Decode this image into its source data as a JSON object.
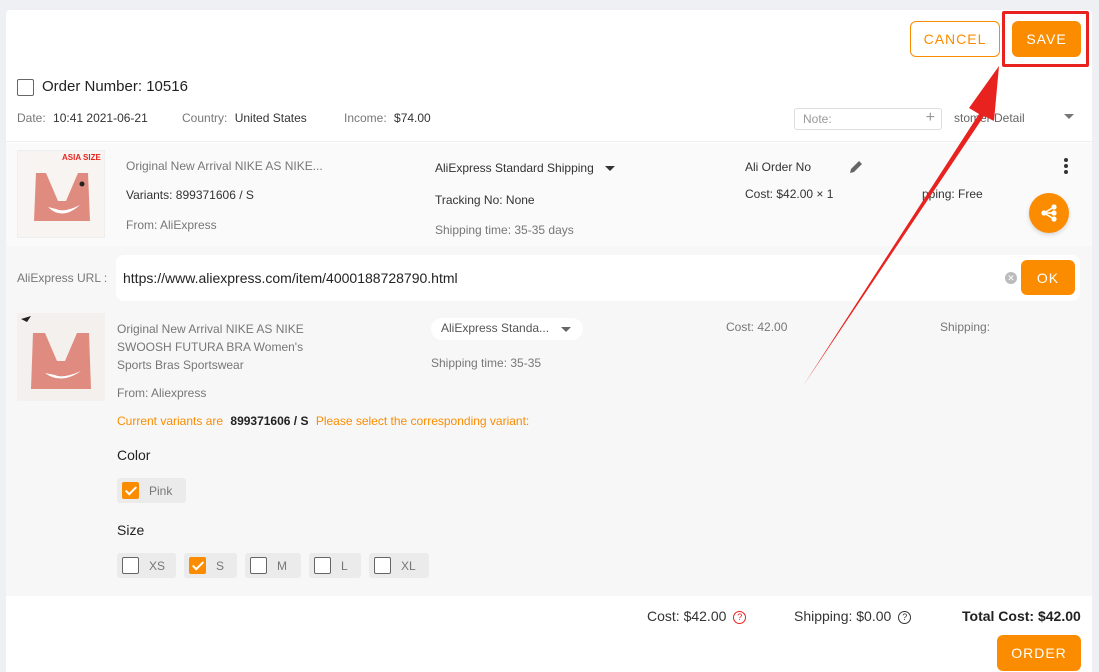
{
  "header": {
    "cancel_label": "CANCEL",
    "save_label": "SAVE"
  },
  "order": {
    "number_label": "Order Number: 10516",
    "date_label": "Date:",
    "date_value": "10:41 2021-06-21",
    "country_label": "Country:",
    "country_value": "United States",
    "income_label": "Income:",
    "income_value": "$74.00",
    "note_placeholder": "Note:",
    "customer_detail": "stomer Detail"
  },
  "item": {
    "badge": "ASIA SIZE",
    "title": "Original New Arrival NIKE AS NIKE...",
    "variants": "Variants: 899371606 / S",
    "from": "From: AliExpress",
    "shipping_method": "AliExpress Standard Shipping",
    "tracking": "Tracking No: None",
    "shipping_time": "Shipping time: 35-35 days",
    "ali_order_no": "Ali Order No",
    "cost": "Cost: $42.00 × 1",
    "shipping": "pping: Free"
  },
  "mapping": {
    "url_label": "AliExpress URL :",
    "url_value": "https://www.aliexpress.com/item/4000188728790.html",
    "ok_label": "OK",
    "product_title_line1": "Original New Arrival NIKE AS NIKE",
    "product_title_line2": "SWOOSH FUTURA BRA Women's",
    "product_title_line3": "Sports Bras Sportswear",
    "from": "From: Aliexpress",
    "shipping_select": "AliExpress Standa...",
    "shipping_time": "Shipping time: 35-35",
    "cost": "Cost: 42.00",
    "shipping": "Shipping:",
    "current_variants_prefix": "Current variants are",
    "current_variants_value": "899371606 / S",
    "current_variants_suffix": "Please select the corresponding variant:",
    "color_heading": "Color",
    "colors": [
      {
        "label": "Pink",
        "checked": true
      }
    ],
    "size_heading": "Size",
    "sizes": [
      {
        "label": "XS",
        "checked": false
      },
      {
        "label": "S",
        "checked": true
      },
      {
        "label": "M",
        "checked": false
      },
      {
        "label": "L",
        "checked": false
      },
      {
        "label": "XL",
        "checked": false
      }
    ]
  },
  "footer": {
    "cost": "Cost: $42.00",
    "shipping": "Shipping: $0.00",
    "total": "Total Cost: $42.00",
    "order_label": "ORDER"
  },
  "colors": {
    "accent": "#fb8c00",
    "annotation": "#e8231f"
  }
}
